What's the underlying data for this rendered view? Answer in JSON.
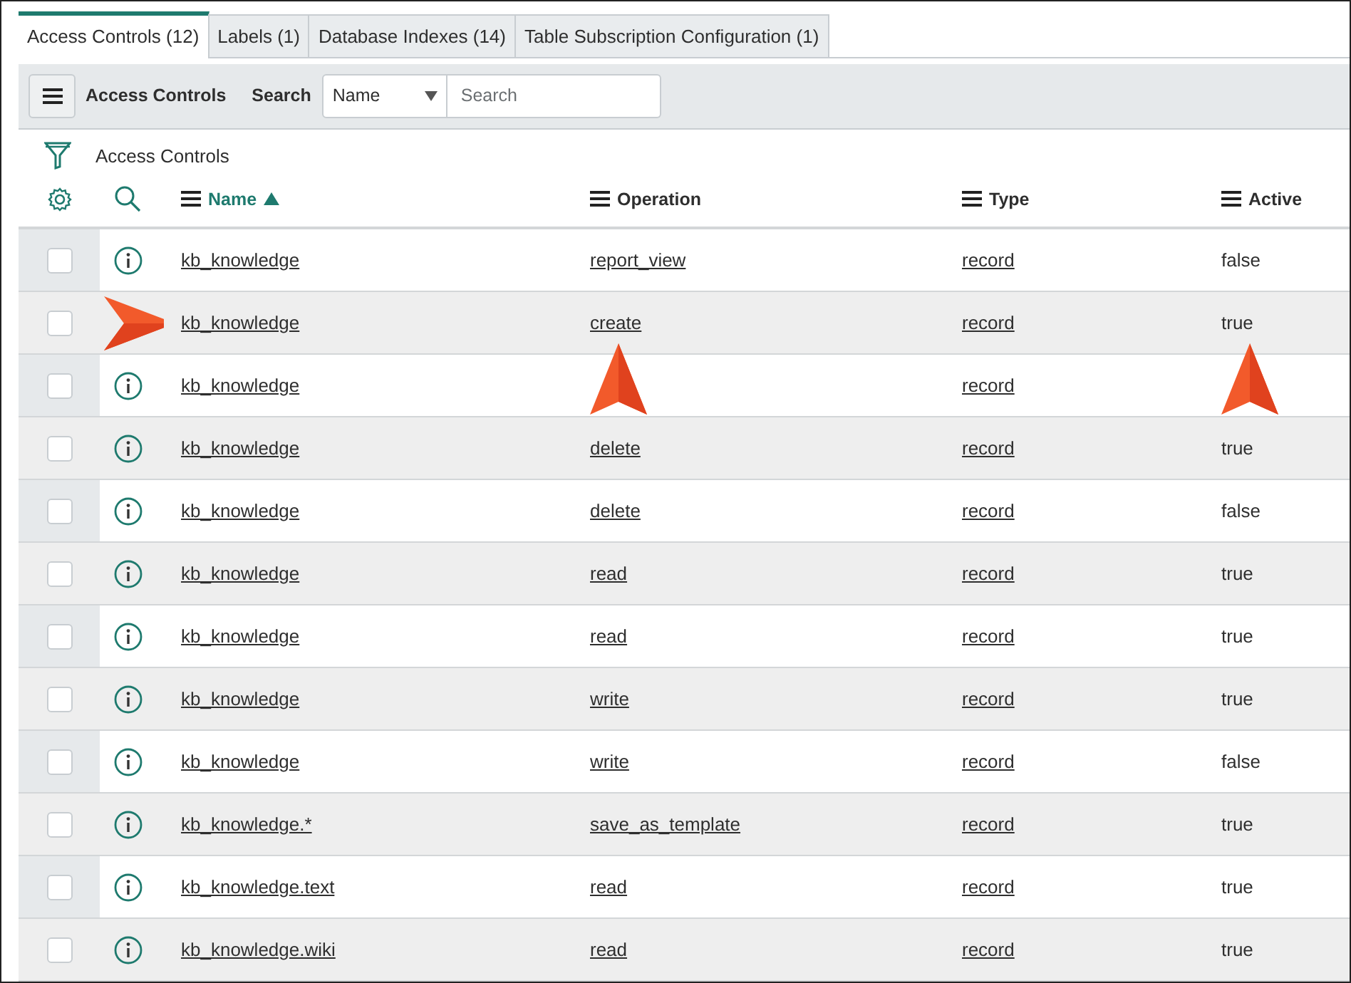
{
  "tabs": [
    {
      "label": "Access Controls (12)",
      "selected": true
    },
    {
      "label": "Labels (1)",
      "selected": false
    },
    {
      "label": "Database Indexes (14)",
      "selected": false
    },
    {
      "label": "Table Subscription Configuration (1)",
      "selected": false
    }
  ],
  "toolbar": {
    "title": "Access Controls",
    "search_label": "Search",
    "field_select": "Name",
    "search": {
      "placeholder": "Search"
    }
  },
  "breadcrumb": "Access Controls",
  "columns": [
    {
      "label": "Name",
      "sorted": true
    },
    {
      "label": "Operation",
      "sorted": false
    },
    {
      "label": "Type",
      "sorted": false
    },
    {
      "label": "Active",
      "sorted": false
    }
  ],
  "rows": [
    {
      "checked": false,
      "info": true,
      "name": "kb_knowledge",
      "operation": "report_view",
      "type": "record",
      "active": "false",
      "info_pointer": false,
      "operation_pointer": false,
      "active_pointer": false
    },
    {
      "checked": false,
      "info": false,
      "name": "kb_knowledge",
      "operation": "create",
      "type": "record",
      "active": "true",
      "info_pointer": true,
      "operation_pointer": false,
      "active_pointer": false
    },
    {
      "checked": false,
      "info": true,
      "name": "kb_knowledge",
      "type": "record",
      "info_pointer": false,
      "operation_pointer": true,
      "active_pointer": true
    },
    {
      "checked": false,
      "info": true,
      "name": "kb_knowledge",
      "operation": "delete",
      "type": "record",
      "active": "true",
      "info_pointer": false,
      "operation_pointer": false,
      "active_pointer": false
    },
    {
      "checked": false,
      "info": true,
      "name": "kb_knowledge",
      "operation": "delete",
      "type": "record",
      "active": "false",
      "info_pointer": false,
      "operation_pointer": false,
      "active_pointer": false
    },
    {
      "checked": false,
      "info": true,
      "name": "kb_knowledge",
      "operation": "read",
      "type": "record",
      "active": "true",
      "info_pointer": false,
      "operation_pointer": false,
      "active_pointer": false
    },
    {
      "checked": false,
      "info": true,
      "name": "kb_knowledge",
      "operation": "read",
      "type": "record",
      "active": "true",
      "info_pointer": false,
      "operation_pointer": false,
      "active_pointer": false
    },
    {
      "checked": false,
      "info": true,
      "name": "kb_knowledge",
      "operation": "write",
      "type": "record",
      "active": "true",
      "info_pointer": false,
      "operation_pointer": false,
      "active_pointer": false
    },
    {
      "checked": false,
      "info": true,
      "name": "kb_knowledge",
      "operation": "write",
      "type": "record",
      "active": "false",
      "info_pointer": false,
      "operation_pointer": false,
      "active_pointer": false
    },
    {
      "checked": false,
      "info": true,
      "name": "kb_knowledge.*",
      "operation": "save_as_template",
      "type": "record",
      "active": "true",
      "info_pointer": false,
      "operation_pointer": false,
      "active_pointer": false
    },
    {
      "checked": false,
      "info": true,
      "name": "kb_knowledge.text",
      "operation": "read",
      "type": "record",
      "active": "true",
      "info_pointer": false,
      "operation_pointer": false,
      "active_pointer": false
    },
    {
      "checked": false,
      "info": true,
      "name": "kb_knowledge.wiki",
      "operation": "read",
      "type": "record",
      "active": "true",
      "info_pointer": false,
      "operation_pointer": false,
      "active_pointer": false
    }
  ]
}
